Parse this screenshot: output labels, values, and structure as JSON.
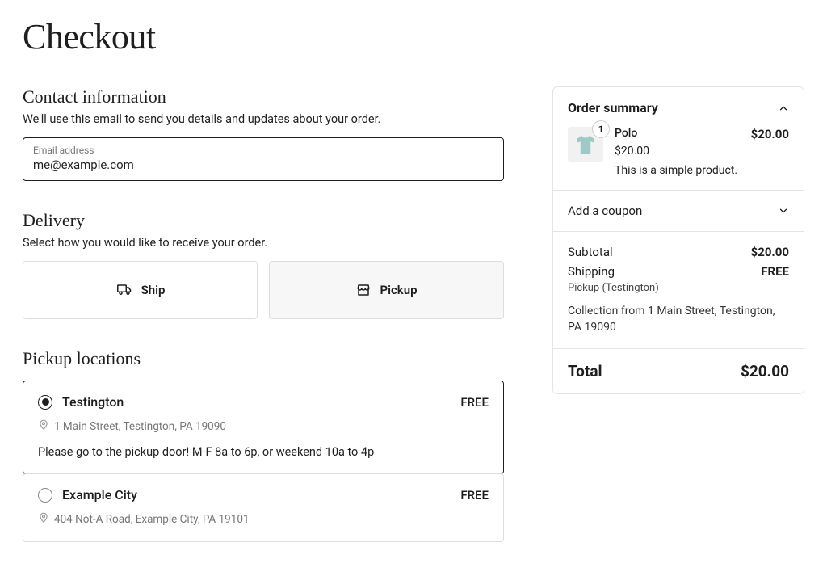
{
  "pageTitle": "Checkout",
  "contact": {
    "title": "Contact information",
    "desc": "We'll use this email to send you details and updates about your order.",
    "emailLabel": "Email address",
    "emailValue": "me@example.com"
  },
  "delivery": {
    "title": "Delivery",
    "desc": "Select how you would like to receive your order.",
    "ship": "Ship",
    "pickup": "Pickup"
  },
  "pickupSection": {
    "title": "Pickup locations",
    "locations": [
      {
        "name": "Testington",
        "price": "FREE",
        "address": "1 Main Street, Testington, PA 19090",
        "instructions": "Please go to the pickup door! M-F 8a to 6p, or weekend 10a to 4p"
      },
      {
        "name": "Example City",
        "price": "FREE",
        "address": "404 Not-A Road, Example City, PA 19101"
      }
    ]
  },
  "summary": {
    "title": "Order summary",
    "item": {
      "qty": "1",
      "name": "Polo",
      "unitPrice": "$20.00",
      "desc": "This is a simple product.",
      "lineTotal": "$20.00"
    },
    "couponLabel": "Add a coupon",
    "subtotalLabel": "Subtotal",
    "subtotalValue": "$20.00",
    "shippingLabel": "Shipping",
    "shippingValue": "FREE",
    "shippingMethod": "Pickup (Testington)",
    "collectionNote": "Collection from 1 Main Street, Testington, PA 19090",
    "totalLabel": "Total",
    "totalValue": "$20.00"
  }
}
